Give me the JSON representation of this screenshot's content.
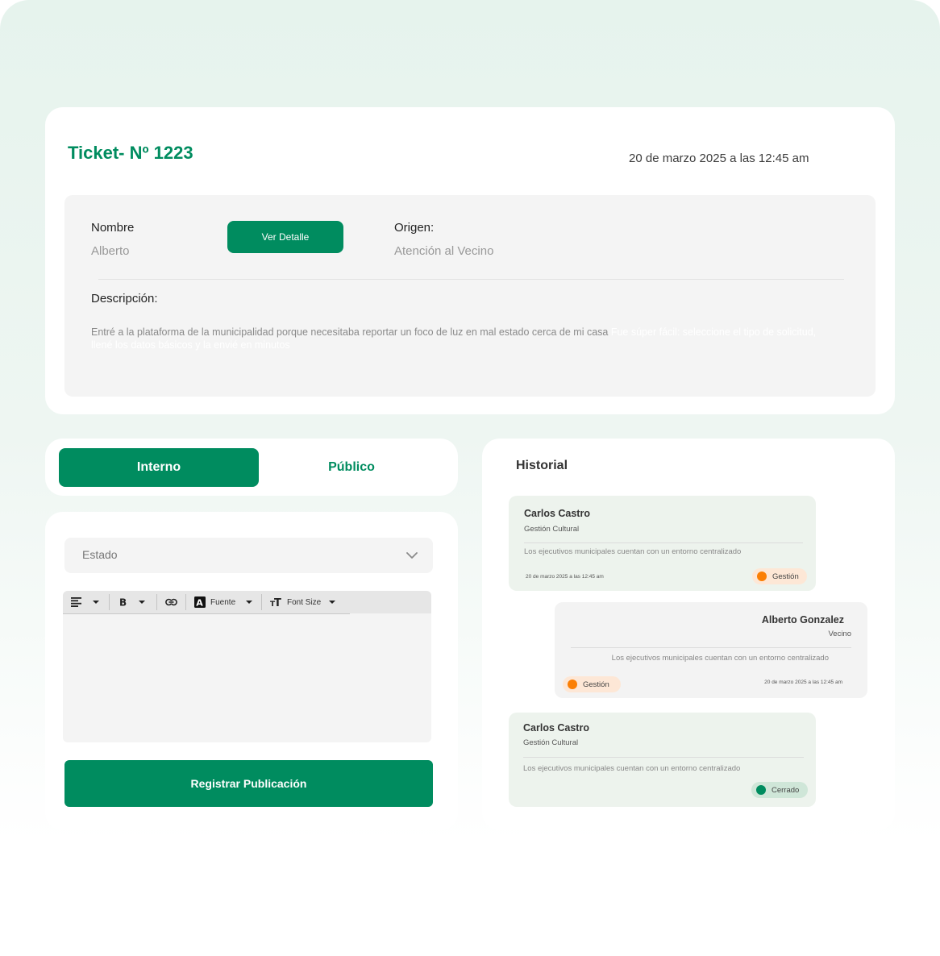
{
  "ticket": {
    "title": "Ticket- Nº 1223",
    "date": "20 de marzo 2025 a las 12:45 am",
    "nombre_label": "Nombre",
    "nombre_value": "Alberto",
    "ver_detalle_label": "Ver Detalle",
    "origen_label": "Origen:",
    "origen_value": "Atención al Vecino",
    "descripcion_label": "Descripción:",
    "descripcion_text": "Entré a la plataforma de la municipalidad porque necesitaba reportar un foco de luz en mal estado cerca de mi casa",
    "descripcion_faded": "Fue súper fácil: seleccione el tipo de solicitud, llené los datos básicos y la envié en minutos"
  },
  "tabs": [
    {
      "label": "Interno",
      "active": true
    },
    {
      "label": "Público",
      "active": false
    }
  ],
  "form": {
    "estado_placeholder": "Estado",
    "toolbar": {
      "align_icon": "align-left-icon",
      "bold_icon": "bold-icon",
      "link_icon": "link-icon",
      "font_label": "Fuente",
      "font_size_label": "Font Size"
    },
    "submit_label": "Registrar Publicación"
  },
  "historial": {
    "title": "Historial",
    "entries": [
      {
        "name": "Carlos Castro",
        "role": "Gestión Cultural",
        "message": "Los ejecutivos municipales cuentan con un entorno centralizado",
        "date": "20 de marzo 2025 a las 12:45 am",
        "status": "Gestión",
        "status_color": "#fb7f04"
      },
      {
        "name": "Alberto Gonzalez",
        "role": "Vecino",
        "message": "Los ejecutivos municipales cuentan con un entorno centralizado",
        "date": "20 de marzo 2025 a las 12:45 am",
        "status": "Gestión",
        "status_color": "#fb7f04"
      },
      {
        "name": "Carlos Castro",
        "role": "Gestión Cultural",
        "message": "Los ejecutivos municipales cuentan con un entorno centralizado",
        "status": "Cerrado",
        "status_color": "#008c5f"
      }
    ]
  },
  "colors": {
    "brand_green": "#008c5f",
    "status_orange": "#fb7f04"
  }
}
